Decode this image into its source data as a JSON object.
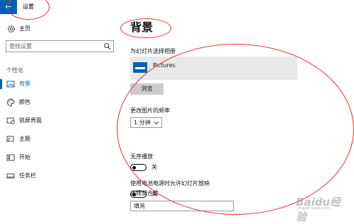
{
  "app": {
    "title": "设置"
  },
  "sidebar": {
    "home_label": "主页",
    "search_placeholder": "查找设置",
    "section_label": "个性化",
    "items": [
      {
        "label": "背景",
        "icon": "picture-icon",
        "active": true
      },
      {
        "label": "颜色",
        "icon": "palette-icon",
        "active": false
      },
      {
        "label": "锁屏界面",
        "icon": "lock-screen-icon",
        "active": false
      },
      {
        "label": "主题",
        "icon": "theme-icon",
        "active": false
      },
      {
        "label": "开始",
        "icon": "start-icon",
        "active": false
      },
      {
        "label": "任务栏",
        "icon": "taskbar-icon",
        "active": false
      }
    ]
  },
  "main": {
    "title": "背景",
    "album_section_label": "为幻灯片选择相册",
    "album_name": "Pictures",
    "browse_label": "浏览",
    "frequency_label": "更改图片的频率",
    "frequency_value": "1 分钟",
    "shuffle_label": "无序播放",
    "shuffle_state": "关",
    "battery_label": "使用电池电源时允许幻灯片放映",
    "battery_state": "关",
    "fit_label": "选择契合度",
    "fit_value": "填充"
  },
  "watermark": {
    "text": "Baidu经验",
    "sub": "jingyan.baidu.com"
  },
  "colors": {
    "accent": "#0063b1",
    "annotation": "#e03030"
  }
}
